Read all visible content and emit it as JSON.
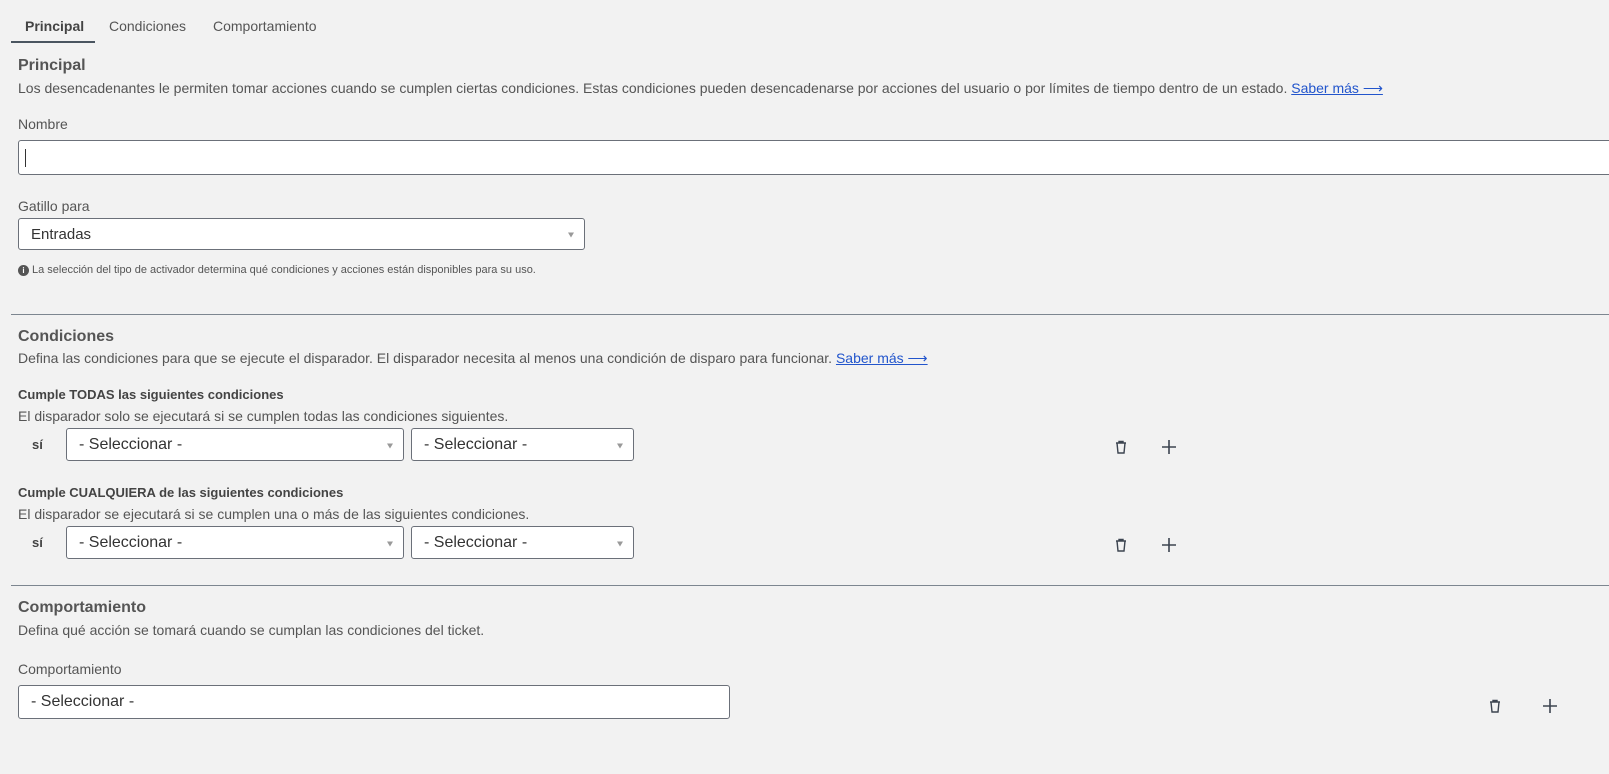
{
  "tabs": [
    {
      "label": "Principal",
      "active": true
    },
    {
      "label": "Condiciones"
    },
    {
      "label": "Comportamiento"
    }
  ],
  "principal": {
    "title": "Principal",
    "description": "Los desencadenantes le permiten tomar acciones cuando se cumplen ciertas condiciones. Estas condiciones pueden desencadenarse por acciones del usuario o por límites de tiempo dentro de un estado.",
    "learn_more": "Saber más ⟶",
    "name_label": "Nombre",
    "name_value": "",
    "trigger_label": "Gatillo para",
    "trigger_value": "Entradas",
    "info_note": "La selección del tipo de activador determina qué condiciones y acciones están disponibles para su uso."
  },
  "conditions": {
    "title": "Condiciones",
    "description": "Defina las condiciones para que se ejecute el disparador. El disparador necesita al menos una condición de disparo para funcionar.",
    "learn_more": "Saber más ⟶",
    "all": {
      "title": "Cumple TODAS las siguientes condiciones",
      "description": "El disparador solo se ejecutará si se cumplen todas las condiciones siguientes.",
      "prefix": "sí",
      "field": "- Seleccionar -",
      "operator": "- Seleccionar -"
    },
    "any": {
      "title": "Cumple CUALQUIERA de las siguientes condiciones",
      "description": "El disparador se ejecutará si se cumplen una o más de las siguientes condiciones.",
      "prefix": "sí",
      "field": "- Seleccionar -",
      "operator": "- Seleccionar -"
    }
  },
  "behavior": {
    "title": "Comportamiento",
    "description": "Defina qué acción se tomará cuando se cumplan las condiciones del ticket.",
    "label": "Comportamiento",
    "value": "- Seleccionar -"
  },
  "colors": {
    "background": "#f2f2f2",
    "link": "#2255cc",
    "text": "#555555"
  }
}
